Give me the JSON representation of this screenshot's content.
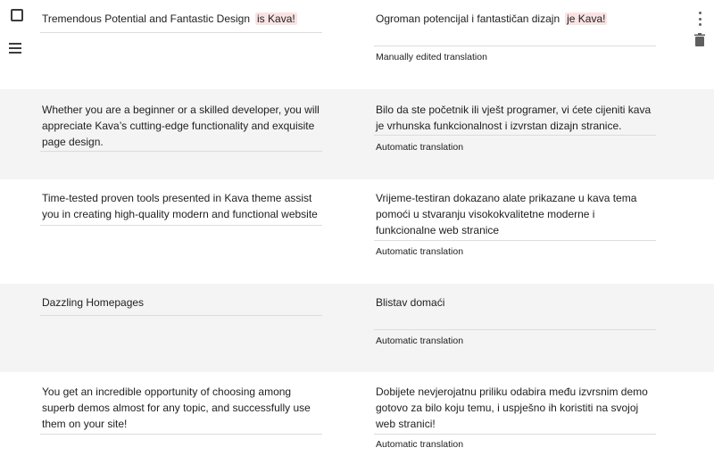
{
  "segments": [
    {
      "source_parts": [
        "Tremendous Potential and Fantastic Design",
        "is Kava!"
      ],
      "target_parts": [
        "Ogroman potencijal i fantastičan dizajn",
        "je Kava!"
      ],
      "status": "Manually edited translation"
    },
    {
      "source": "Whether you are a beginner or a skilled developer, you will appreciate Kava’s cutting-edge functionality and exquisite page design.",
      "target": "Bilo da ste početnik ili vješt programer, vi ćete cijeniti kava je vrhunska funkcionalnost i izvrstan dizajn stranice.",
      "status": "Automatic translation"
    },
    {
      "source": "Time-tested proven tools presented in Kava theme assist you in creating high-quality modern and functional website",
      "target": "Vrijeme-testiran dokazano alate prikazane u kava tema pomoći u stvaranju visokokvalitetne moderne i funkcionalne web stranice",
      "status": "Automatic translation"
    },
    {
      "source": "Dazzling Homepages",
      "target": "Blistav domaći",
      "status": "Automatic translation"
    },
    {
      "source": "You get an incredible opportunity of choosing among superb demos almost for any topic, and successfully use them on your site!",
      "target": "Dobijete nevjerojatnu priliku odabira među izvrsnim demo gotovo za bilo koju temu, i uspješno ih koristiti na svojoj web stranici!",
      "status": "Automatic translation"
    }
  ],
  "icons": {
    "select": "checkbox-icon",
    "reorder": "drag-handle-icon",
    "more": "more-vert-icon",
    "delete": "trash-icon"
  },
  "colors": {
    "alt_row_bg": "#f4f4f4",
    "tag_highlight": "#fbe3e3",
    "divider": "#dcdcdc",
    "icon": "#5f5f5f"
  }
}
